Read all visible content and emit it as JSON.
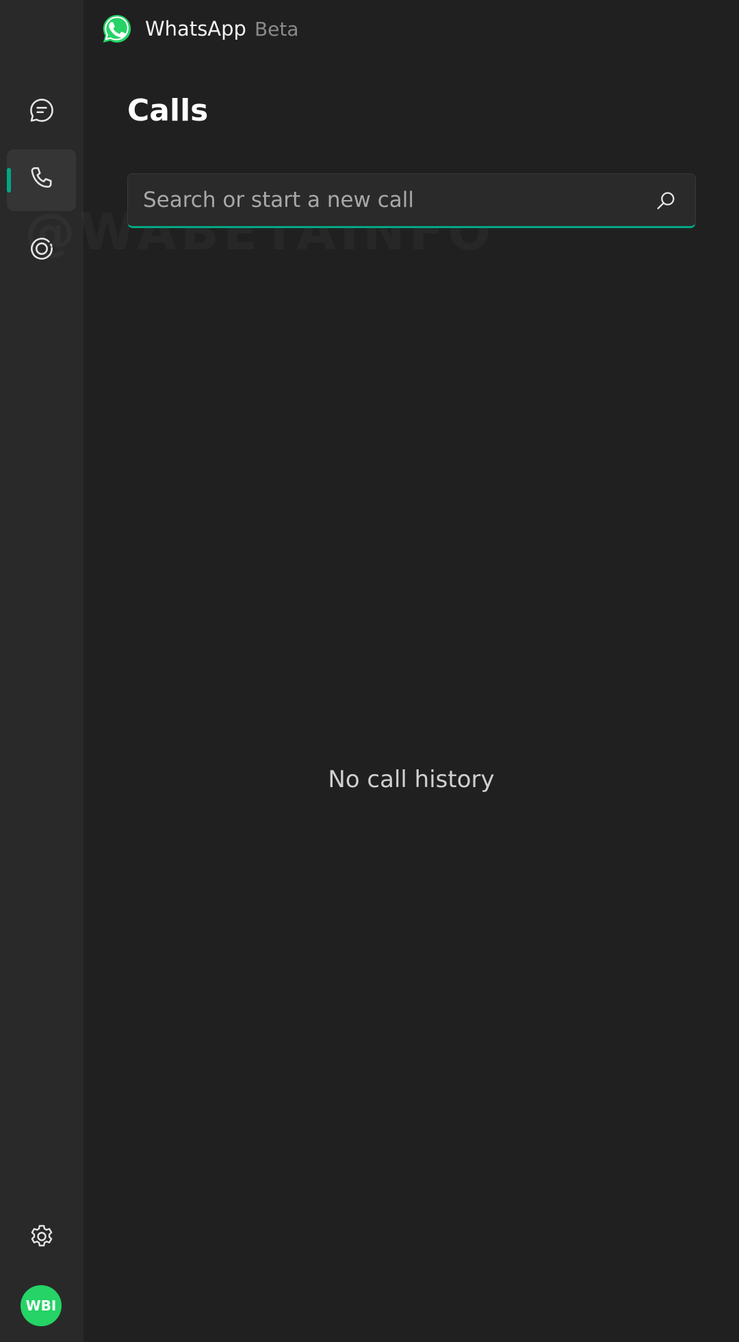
{
  "app": {
    "name": "WhatsApp",
    "tag": "Beta",
    "logo_icon": "whatsapp-logo-icon",
    "brand_color": "#25d366",
    "accent_color": "#00a884"
  },
  "sidebar": {
    "items": [
      {
        "id": "chats",
        "icon": "chat-icon",
        "active": false
      },
      {
        "id": "calls",
        "icon": "phone-icon",
        "active": true
      },
      {
        "id": "status",
        "icon": "status-icon",
        "active": false
      }
    ],
    "bottom": {
      "settings_icon": "gear-icon",
      "avatar_text": "WBI"
    }
  },
  "main": {
    "title": "Calls",
    "search": {
      "placeholder": "Search or start a new call",
      "value": "",
      "icon": "search-icon"
    },
    "empty_state": "No call history"
  },
  "watermark": "@WABETAINFO"
}
